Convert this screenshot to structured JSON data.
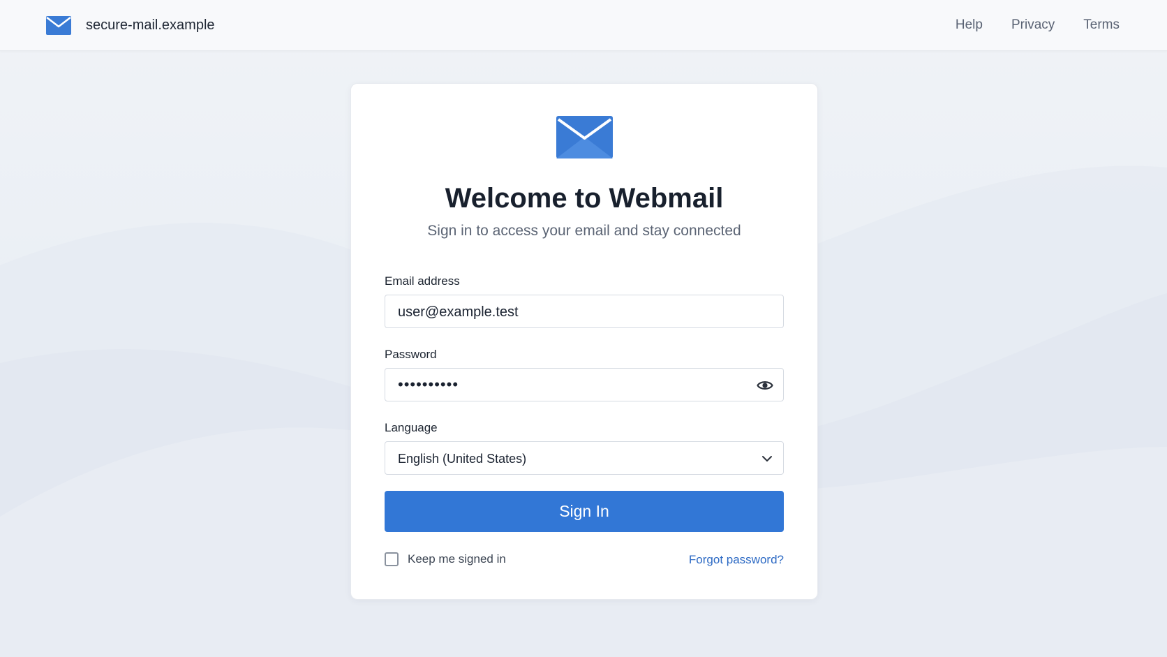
{
  "header": {
    "brand_name": "secure-mail.example",
    "brand_icon": "envelope-icon",
    "nav": [
      "Help",
      "Privacy",
      "Terms"
    ]
  },
  "login": {
    "icon": "envelope-icon",
    "title": "Welcome to Webmail",
    "subtitle": "Sign in to access your email and stay connected",
    "email": {
      "label": "Email address",
      "value": "user@example.test"
    },
    "password": {
      "label": "Password",
      "masked_value": "••••••••••",
      "toggle_icon": "eye-icon"
    },
    "language": {
      "label": "Language",
      "selected": "English (United States)",
      "icon": "chevron-down-icon"
    },
    "submit_label": "Sign In",
    "remember_label": "Keep me signed in",
    "remember_checked": false,
    "forgot_label": "Forgot password?"
  },
  "colors": {
    "accent": "#3277d6",
    "link": "#2d6ac4",
    "title": "#18202d",
    "background": "#eef1f5"
  }
}
